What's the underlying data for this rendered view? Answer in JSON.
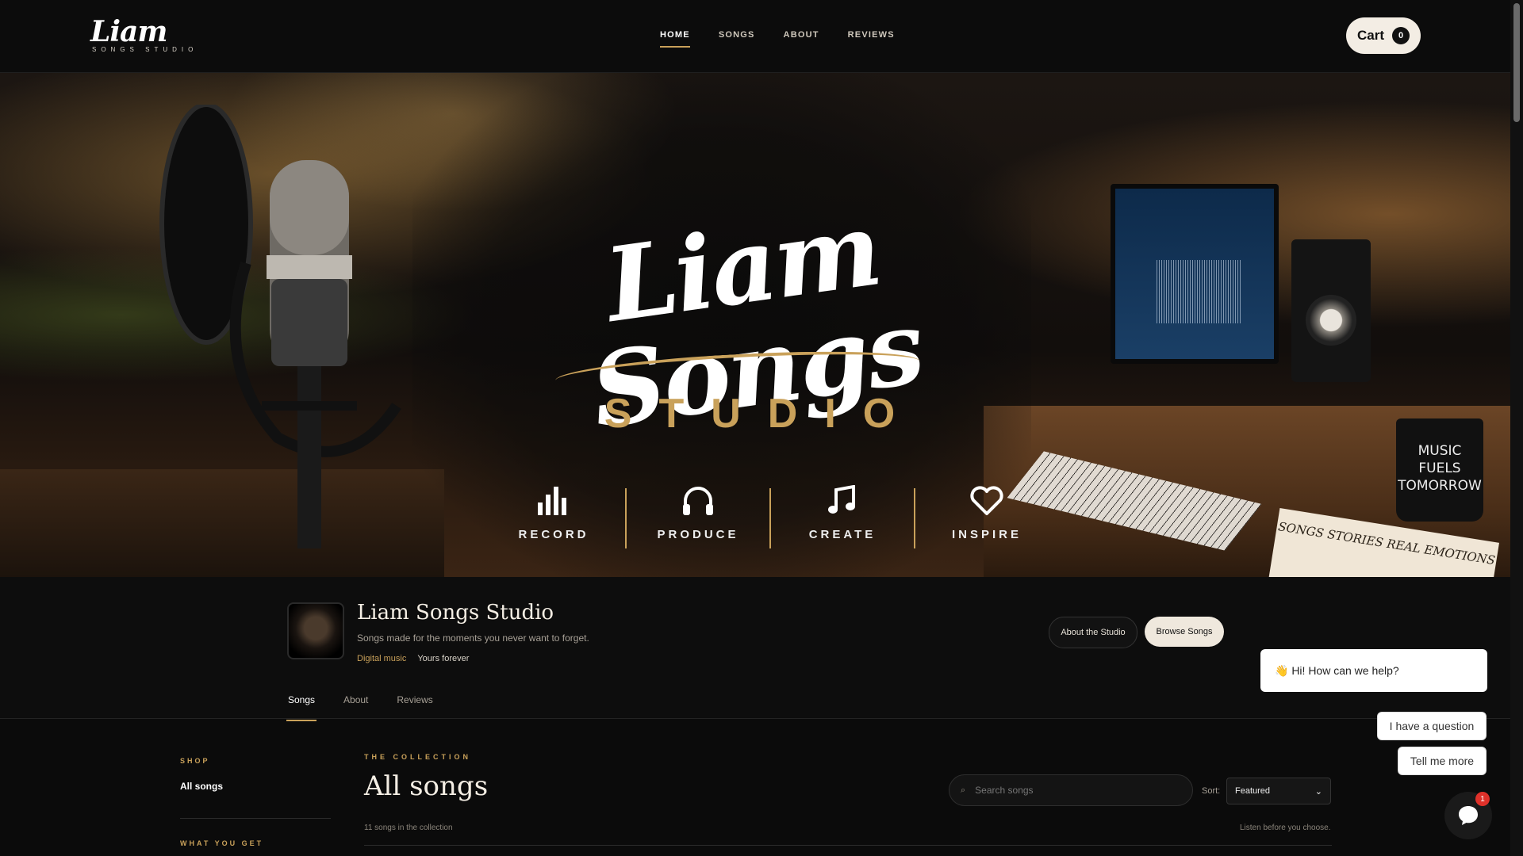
{
  "header": {
    "logo_script": "Liam",
    "logo_sub": "SONGS STUDIO",
    "nav": [
      {
        "label": "HOME"
      },
      {
        "label": "SONGS"
      },
      {
        "label": "ABOUT"
      },
      {
        "label": "REVIEWS"
      }
    ],
    "cart_label": "Cart",
    "cart_count": "0"
  },
  "hero": {
    "title": "Liam Songs",
    "subtitle": "STUDIO",
    "pillars": [
      {
        "label": "RECORD",
        "icon": "bar-chart-icon"
      },
      {
        "label": "PRODUCE",
        "icon": "headphones-icon"
      },
      {
        "label": "CREATE",
        "icon": "music-note-icon"
      },
      {
        "label": "INSPIRE",
        "icon": "heart-icon"
      }
    ],
    "mug_text": "MUSIC FUELS TOMORROW",
    "notebook_text": "SONGS STORIES REAL EMOTIONS"
  },
  "studio": {
    "name": "Liam Songs Studio",
    "tagline": "Songs made for the moments you never want to forget.",
    "meta_primary": "Digital music",
    "meta_secondary": "Yours forever",
    "about_button": "About the Studio",
    "browse_button": "Browse Songs",
    "tabs": [
      {
        "label": "Songs"
      },
      {
        "label": "About"
      },
      {
        "label": "Reviews"
      }
    ]
  },
  "sidebar": {
    "shop_label": "SHOP",
    "all_songs": "All songs",
    "what_you_get_label": "WHAT YOU GET"
  },
  "collection": {
    "eyebrow": "THE COLLECTION",
    "title": "All songs",
    "search_placeholder": "Search songs",
    "sort_label": "Sort:",
    "sort_value": "Featured",
    "count_text": "11 songs in the collection",
    "listen_text": "Listen before you choose."
  },
  "chat": {
    "greeting": "👋 Hi! How can we help?",
    "option_1": "I have a question",
    "option_2": "Tell me more",
    "badge": "1"
  },
  "colors": {
    "accent_gold": "#c9a15a",
    "background": "#0b0b0b",
    "cream": "#efe8dd"
  }
}
